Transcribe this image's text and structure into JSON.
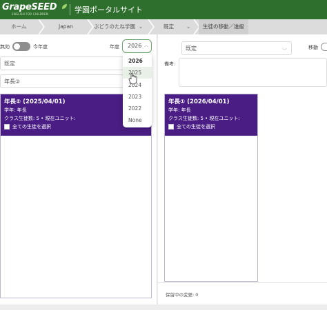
{
  "header": {
    "logo_text": "GrapeSEED",
    "logo_tagline": "ENGLISH FOR CHILDREN",
    "app_title": "学園ポータルサイト",
    "brand_color": "#2f6f2d"
  },
  "breadcrumb": {
    "items": [
      "ホーム",
      "Japan",
      "ぶどうのたね学園",
      "既定",
      "生徒の移動／進級"
    ],
    "chevron": "⌄"
  },
  "left": {
    "toggle_label": "無効",
    "current_year_label": "今年度",
    "year_label": "年度",
    "year_value": "2026",
    "campus_select": "既定",
    "class_select": "年長②",
    "year_dropdown": {
      "options": [
        "2026",
        "2025",
        "2024",
        "2023",
        "2022",
        "None"
      ],
      "selected": "2026",
      "hovered": "2025"
    },
    "panel": {
      "title": "年長② (2025/04/01)",
      "grade": "学年: 年長",
      "info": "クラス生徒数: 5 • 現在ユニット:",
      "select_all": "全ての生徒を選択",
      "accent_color": "#4a1d84"
    }
  },
  "right": {
    "campus_select": "既定",
    "move_label": "移動",
    "remarks_label": "備考:",
    "panel": {
      "title": "年長① (2026/04/01)",
      "grade": "学年: 年長",
      "info": "クラス生徒数: 5 • 現在ユニット:",
      "select_all": "全ての生徒を選択"
    },
    "pending_changes": "保留中の変更: 0"
  }
}
